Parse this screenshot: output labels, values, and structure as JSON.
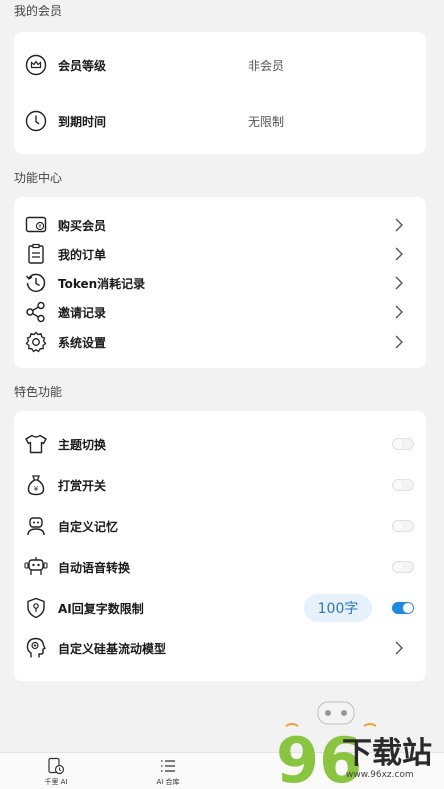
{
  "membership": {
    "section_title": "我的会员",
    "rows": [
      {
        "label": "会员等级",
        "value": "非会员",
        "icon": "crown-icon"
      },
      {
        "label": "到期时间",
        "value": "无限制",
        "icon": "clock-icon"
      }
    ]
  },
  "functions": {
    "section_title": "功能中心",
    "items": [
      {
        "label": "购买会员",
        "icon": "wallet-yen-icon"
      },
      {
        "label": "我的订单",
        "icon": "clipboard-icon"
      },
      {
        "label": "Token消耗记录",
        "icon": "history-icon"
      },
      {
        "label": "邀请记录",
        "icon": "share-icon"
      },
      {
        "label": "系统设置",
        "icon": "gear-icon"
      }
    ]
  },
  "features": {
    "section_title": "特色功能",
    "items": [
      {
        "label": "主题切换",
        "icon": "tshirt-icon",
        "toggle": false
      },
      {
        "label": "打赏开关",
        "icon": "money-bag-icon",
        "toggle": false
      },
      {
        "label": "自定义记忆",
        "icon": "robot-icon",
        "toggle": false
      },
      {
        "label": "自动语音转换",
        "icon": "robot-speaker-icon",
        "toggle": false
      },
      {
        "label": "AI回复字数限制",
        "icon": "shield-icon",
        "toggle": true,
        "badge": "100字"
      },
      {
        "label": "自定义硅基流动模型",
        "icon": "head-brain-icon"
      }
    ]
  },
  "bottom_nav": [
    {
      "label": "千里 AI",
      "icon": "doc-clock-icon"
    },
    {
      "label": "AI 合库",
      "icon": "list-icon"
    }
  ],
  "watermark": {
    "main": "下载站",
    "digits": "96",
    "url": "www.96xz.com"
  },
  "colors": {
    "accent": "#1e88e5",
    "badge_bg": "#e6f1fb",
    "badge_text": "#2b78c5"
  }
}
